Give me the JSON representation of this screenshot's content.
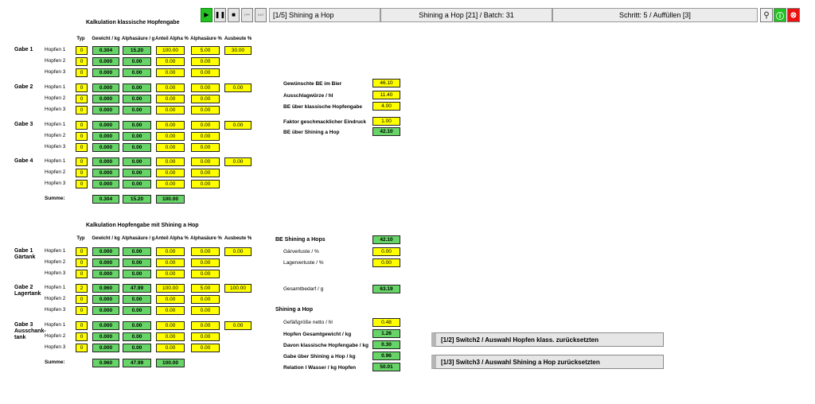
{
  "toolbar": {
    "step_info": "[1/5] Shining a Hop",
    "batch_info": "Shining a Hop [21]  /  Batch: 31",
    "step_status": "Schritt: 5  /  Auffüllen [3]"
  },
  "cols": [
    "Typ",
    "Gewicht / kg",
    "Alphasäure / g",
    "Anteil Alpha %",
    "Alphasäure %",
    "Ausbeute %"
  ],
  "hopfen": [
    "Hopfen 1",
    "Hopfen 2",
    "Hopfen 3"
  ],
  "summe": "Summe:",
  "t1": {
    "title": "Kalkulation klassische Hopfengabe",
    "groups": [
      {
        "label": "Gabe 1",
        "ausbeute": "30.00",
        "rows": [
          [
            "0",
            "0.304",
            "15.20",
            "100.00",
            "5.00"
          ],
          [
            "0",
            "0.000",
            "0.00",
            "0.00",
            "0.00"
          ],
          [
            "0",
            "0.000",
            "0.00",
            "0.00",
            "0.00"
          ]
        ]
      },
      {
        "label": "Gabe 2",
        "ausbeute": "0.00",
        "rows": [
          [
            "0",
            "0.000",
            "0.00",
            "0.00",
            "0.00"
          ],
          [
            "0",
            "0.000",
            "0.00",
            "0.00",
            "0.00"
          ],
          [
            "0",
            "0.000",
            "0.00",
            "0.00",
            "0.00"
          ]
        ]
      },
      {
        "label": "Gabe 3",
        "ausbeute": "0.00",
        "rows": [
          [
            "0",
            "0.000",
            "0.00",
            "0.00",
            "0.00"
          ],
          [
            "0",
            "0.000",
            "0.00",
            "0.00",
            "0.00"
          ],
          [
            "0",
            "0.000",
            "0.00",
            "0.00",
            "0.00"
          ]
        ]
      },
      {
        "label": "Gabe 4",
        "ausbeute": "0.00",
        "rows": [
          [
            "0",
            "0.000",
            "0.00",
            "0.00",
            "0.00"
          ],
          [
            "0",
            "0.000",
            "0.00",
            "0.00",
            "0.00"
          ],
          [
            "0",
            "0.000",
            "0.00",
            "0.00",
            "0.00"
          ]
        ]
      }
    ],
    "sum": [
      "0.304",
      "15.20",
      "100.00"
    ]
  },
  "t2": {
    "title": "Kalkulation Hopfengabe mit Shining a Hop",
    "groups": [
      {
        "label": "Gabe 1 Gärtank",
        "ausbeute": "0.00",
        "rows": [
          [
            "0",
            "0.000",
            "0.00",
            "0.00",
            "0.00"
          ],
          [
            "0",
            "0.000",
            "0.00",
            "0.00",
            "0.00"
          ],
          [
            "0",
            "0.000",
            "0.00",
            "0.00",
            "0.00"
          ]
        ]
      },
      {
        "label": "Gabe 2 Lagertank",
        "ausbeute": "100.00",
        "rows": [
          [
            "2",
            "0.960",
            "47.99",
            "100.00",
            "5.00"
          ],
          [
            "0",
            "0.000",
            "0.00",
            "0.00",
            "0.00"
          ],
          [
            "0",
            "0.000",
            "0.00",
            "0.00",
            "0.00"
          ]
        ]
      },
      {
        "label": "Gabe 3 Ausschank-tank",
        "ausbeute": "0.00",
        "rows": [
          [
            "0",
            "0.000",
            "0.00",
            "0.00",
            "0.00"
          ],
          [
            "0",
            "0.000",
            "0.00",
            "0.00",
            "0.00"
          ],
          [
            "0",
            "0.000",
            "0.00",
            "0.00",
            "0.00"
          ]
        ]
      }
    ],
    "sum": [
      "0.960",
      "47.99",
      "100.00"
    ]
  },
  "be": {
    "gewuenscht_label": "Gewünschte BE im Bier",
    "gewuenscht": "46.10",
    "ausschlag_label": "Ausschlagwürze / hl",
    "ausschlag": "11.40",
    "klassisch_label": "BE über klassische Hopfengabe",
    "klassisch": "4.00",
    "faktor_label": "Faktor geschmacklicher Eindruck",
    "faktor": "1.00",
    "sah_label": "BE über Shining a Hop",
    "sah": "42.10"
  },
  "sah": {
    "be_label": "BE Shining a Hops",
    "be": "42.10",
    "gaer_label": "Gärverluste / %",
    "gaer": "0.00",
    "lager_label": "Lagerverluste / %",
    "lager": "0.00",
    "bedarf_label": "Gesamtbedarf / g",
    "bedarf": "63.19",
    "section": "Shining a Hop",
    "gefaess_label": "Gefäßgröße netto / hl",
    "gefaess": "0.48",
    "gesamt_label": "Hopfen Gesamtgewicht / kg",
    "gesamt": "1.26",
    "davon_label": "Davon klassische Hopfengabe / kg",
    "davon": "0.30",
    "gabe_label": "Gabe über Shining a Hop / kg",
    "gabe": "0.96",
    "relation_label": "Relation l Wasser / kg Hopfen",
    "relation": "50.01"
  },
  "buttons": {
    "switch2": "[1/2] Switch2 / Auswahl Hopfen klass. zurücksetzten",
    "switch3": "[1/3] Switch3 / Auswahl Shining a Hop zurücksetzten"
  }
}
